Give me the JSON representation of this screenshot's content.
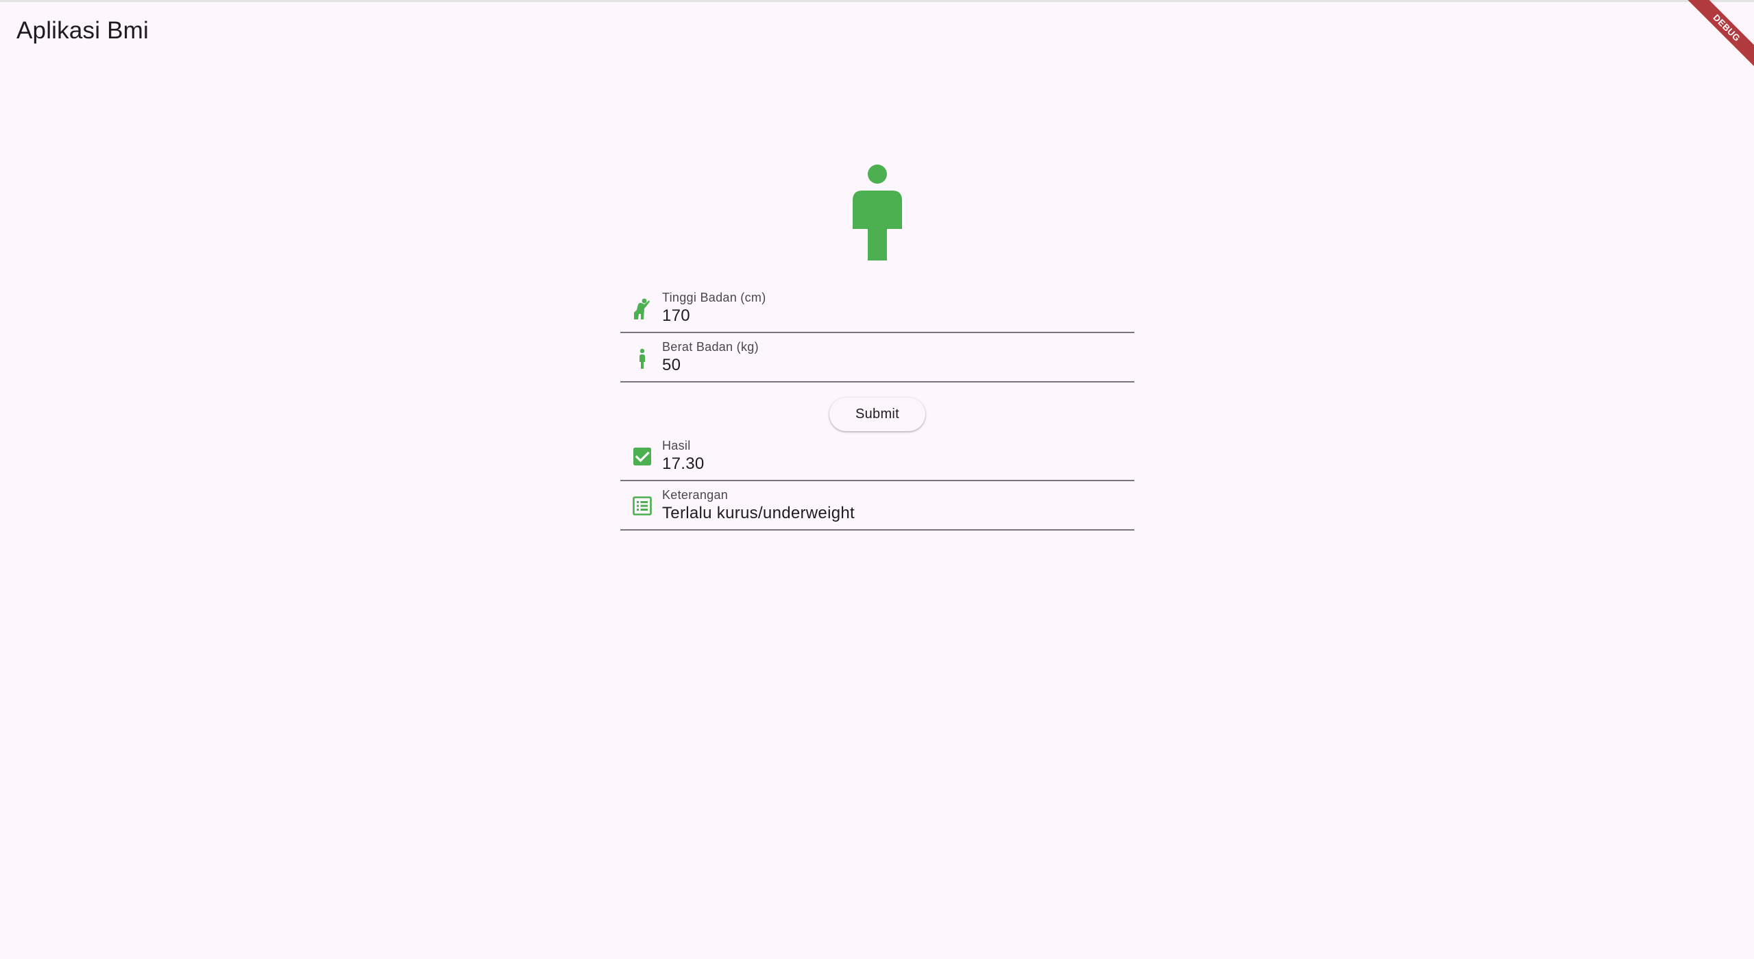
{
  "app": {
    "title": "Aplikasi Bmi",
    "debug_label": "DEBUG"
  },
  "hero": {
    "icon": "person-icon",
    "color": "#4caf50"
  },
  "form": {
    "height": {
      "icon": "accessibility-new-icon",
      "label": "Tinggi Badan (cm)",
      "value": "170"
    },
    "weight": {
      "icon": "person-small-icon",
      "label": "Berat Badan (kg)",
      "value": "50"
    },
    "submit_label": "Submit"
  },
  "result": {
    "bmi": {
      "icon": "check-box-icon",
      "label": "Hasil",
      "value": "17.30"
    },
    "category": {
      "icon": "list-alt-icon",
      "label": "Keterangan",
      "value": "Terlalu kurus/underweight"
    }
  },
  "colors": {
    "accent": "#4caf50",
    "background": "#fdf7fd",
    "debug_banner": "#b13a3e"
  }
}
